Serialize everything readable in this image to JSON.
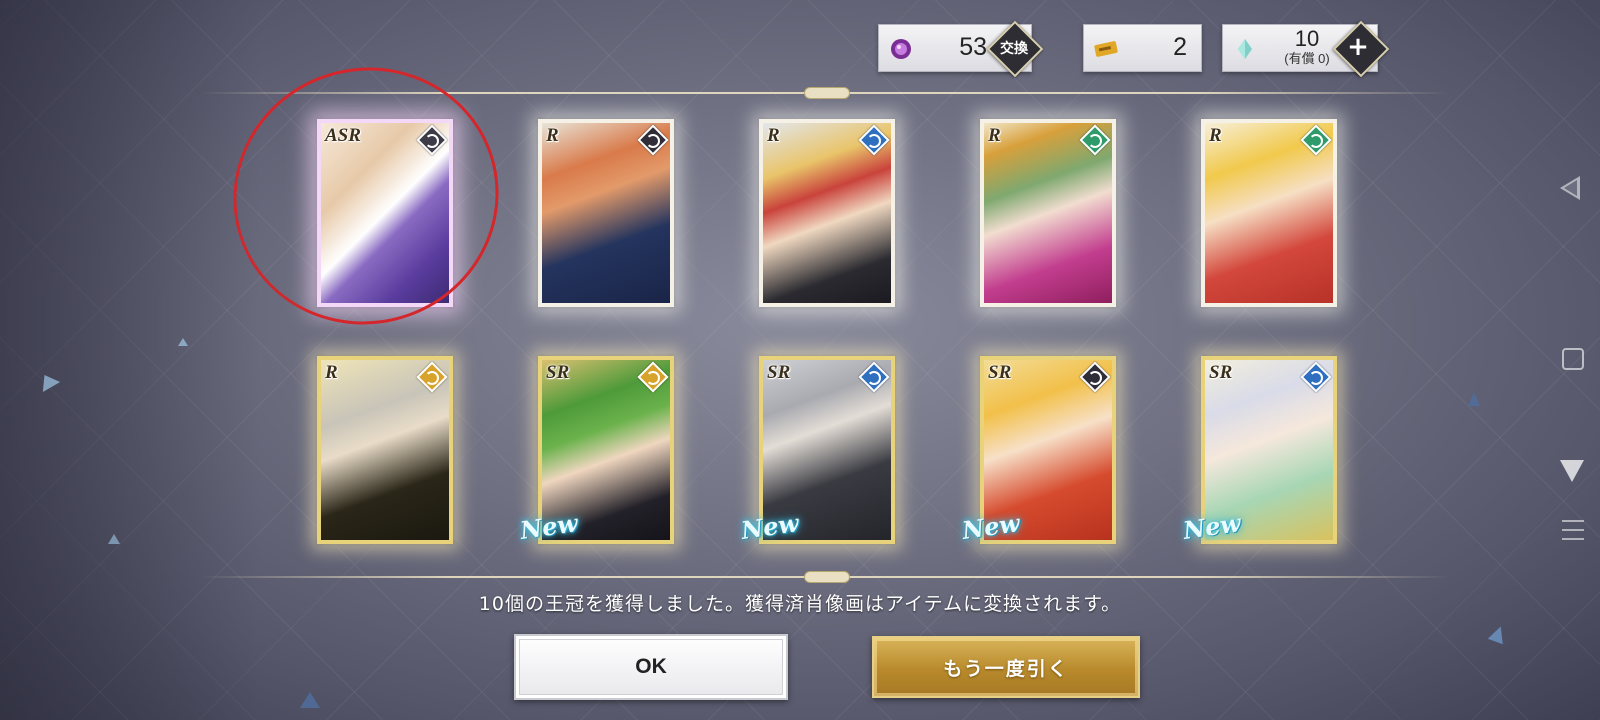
{
  "currency": {
    "gem_value": "53",
    "exchange_label": "交換",
    "ticket_value": "2",
    "crystal_value": "10",
    "crystal_paid_label": "(有償 0)",
    "plus_label": "+"
  },
  "cards": [
    {
      "rarity": "ASR",
      "element_color": "#3c3b47",
      "new": false
    },
    {
      "rarity": "R",
      "element_color": "#2f2e38",
      "new": false
    },
    {
      "rarity": "R",
      "element_color": "#2f6fc0",
      "new": false
    },
    {
      "rarity": "R",
      "element_color": "#2f9a6a",
      "new": false
    },
    {
      "rarity": "R",
      "element_color": "#2f9a6a",
      "new": false
    },
    {
      "rarity": "R",
      "element_color": "#d8a32b",
      "new": false
    },
    {
      "rarity": "SR",
      "element_color": "#d8a32b",
      "new": true
    },
    {
      "rarity": "SR",
      "element_color": "#2f6fc0",
      "new": true
    },
    {
      "rarity": "SR",
      "element_color": "#2f2e38",
      "new": true
    },
    {
      "rarity": "SR",
      "element_color": "#2f6fc0",
      "new": true
    }
  ],
  "new_label": "New",
  "message": "10個の王冠を獲得しました。獲得済肖像画はアイテムに変換されます。",
  "buttons": {
    "ok_label": "OK",
    "draw_again_label": "もう一度引く"
  }
}
